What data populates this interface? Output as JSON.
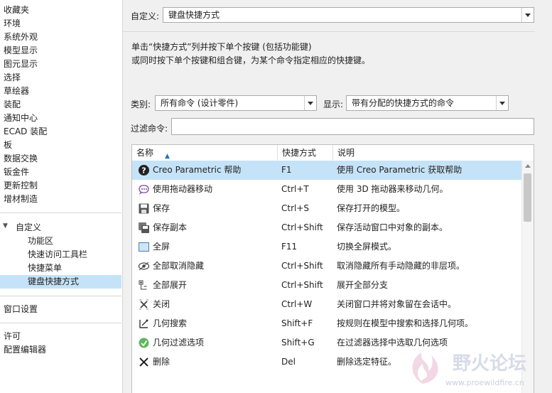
{
  "sidebar": {
    "items": [
      "收藏夹",
      "环境",
      "系统外观",
      "模型显示",
      "图元显示",
      "选择",
      "草绘器",
      "装配",
      "通知中心",
      "ECAD 装配",
      "板",
      "数据交换",
      "钣金件",
      "更新控制",
      "增材制造"
    ],
    "customize_label": "自定义",
    "customize_children": [
      "功能区",
      "快速访问工具栏",
      "快捷菜单",
      "键盘快捷方式"
    ],
    "window_settings": "窗口设置",
    "license": "许可",
    "config_editor": "配置编辑器"
  },
  "main": {
    "customize_label": "自定义:",
    "customize_value": "键盘快捷方式",
    "instructions_line1": "单击“快捷方式”列并按下单个按键 (包括功能键)",
    "instructions_line2": "或同时按下单个按键和组合键，为某个命令指定相应的快捷键。",
    "category_label": "类别:",
    "category_value": "所有命令 (设计零件)",
    "display_label": "显示:",
    "display_value": "带有分配的快捷方式的命令",
    "filter_label": "过滤命令:",
    "filter_value": ""
  },
  "table": {
    "headers": {
      "name": "名称",
      "shortcut": "快捷方式",
      "desc": "说明"
    },
    "rows": [
      {
        "icon": "help-icon",
        "name": "Creo Parametric 帮助",
        "shortcut": "F1",
        "desc": "使用 Creo Parametric 获取帮助"
      },
      {
        "icon": "dragger-icon",
        "name": "使用拖动器移动",
        "shortcut": "Ctrl+T",
        "desc": "使用 3D 拖动器来移动几何。"
      },
      {
        "icon": "save-icon",
        "name": "保存",
        "shortcut": "Ctrl+S",
        "desc": "保存打开的模型。"
      },
      {
        "icon": "save-copy-icon",
        "name": "保存副本",
        "shortcut": "Ctrl+Shift",
        "desc": "保存活动窗口中对象的副本。"
      },
      {
        "icon": "fullscreen-icon",
        "name": "全屏",
        "shortcut": "F11",
        "desc": "切换全屏模式。"
      },
      {
        "icon": "unhide-icon",
        "name": "全部取消隐藏",
        "shortcut": "Ctrl+Shift",
        "desc": "取消隐藏所有手动隐藏的非层项。"
      },
      {
        "icon": "expand-all-icon",
        "name": "全部展开",
        "shortcut": "Ctrl+Shift",
        "desc": "展开全部分支"
      },
      {
        "icon": "close-icon",
        "name": "关闭",
        "shortcut": "Ctrl+W",
        "desc": "关闭窗口并将对象留在会话中。"
      },
      {
        "icon": "geometry-search-icon",
        "name": "几何搜索",
        "shortcut": "Shift+F",
        "desc": "按规则在模型中搜索和选择几何项。"
      },
      {
        "icon": "geometry-filter-icon",
        "name": "几何过滤选项",
        "shortcut": "Shift+G",
        "desc": "在过滤器选择中选取几何选项"
      },
      {
        "icon": "delete-icon",
        "name": "删除",
        "shortcut": "Del",
        "desc": "删除选定特征。"
      }
    ]
  },
  "watermark": {
    "title": "野火论坛",
    "url": "www.proewildfire.cn"
  }
}
